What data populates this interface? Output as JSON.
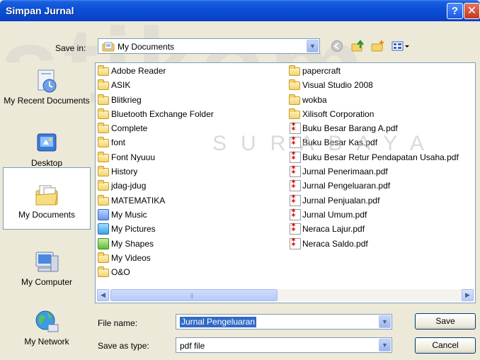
{
  "window": {
    "title": "Simpan Jurnal",
    "help_label": "?",
    "close_label": "✕"
  },
  "watermark": {
    "big": "stikom",
    "small": "SURABAYA"
  },
  "save_in": {
    "label": "Save in:",
    "value": "My Documents"
  },
  "places": [
    {
      "label": "My Recent Documents",
      "icon": "recent-documents-icon"
    },
    {
      "label": "Desktop",
      "icon": "desktop-icon"
    },
    {
      "label": "My Documents",
      "icon": "my-documents-icon"
    },
    {
      "label": "My Computer",
      "icon": "my-computer-icon"
    },
    {
      "label": "My Network",
      "icon": "my-network-icon"
    }
  ],
  "files_col1": [
    {
      "name": "Adobe Reader",
      "type": "folder"
    },
    {
      "name": "ASIK",
      "type": "folder"
    },
    {
      "name": "Blitkrieg",
      "type": "folder"
    },
    {
      "name": "Bluetooth Exchange Folder",
      "type": "folder"
    },
    {
      "name": "Complete",
      "type": "folder"
    },
    {
      "name": "font",
      "type": "folder"
    },
    {
      "name": "Font Nyuuu",
      "type": "folder"
    },
    {
      "name": "History",
      "type": "folder"
    },
    {
      "name": "jdag-jdug",
      "type": "folder"
    },
    {
      "name": "MATEMATIKA",
      "type": "folder"
    },
    {
      "name": "My Music",
      "type": "music"
    },
    {
      "name": "My Pictures",
      "type": "pictures"
    },
    {
      "name": "My Shapes",
      "type": "shapes"
    },
    {
      "name": "My Videos",
      "type": "folder"
    },
    {
      "name": "O&O",
      "type": "folder"
    }
  ],
  "files_col2": [
    {
      "name": "papercraft",
      "type": "folder"
    },
    {
      "name": "Visual Studio 2008",
      "type": "folder"
    },
    {
      "name": "wokba",
      "type": "folder"
    },
    {
      "name": "Xilisoft Corporation",
      "type": "folder"
    },
    {
      "name": "Buku Besar Barang A.pdf",
      "type": "pdf"
    },
    {
      "name": "Buku Besar Kas.pdf",
      "type": "pdf"
    },
    {
      "name": "Buku Besar Retur Pendapatan Usaha.pdf",
      "type": "pdf"
    },
    {
      "name": "Jurnal Penerimaan.pdf",
      "type": "pdf"
    },
    {
      "name": "Jurnal Pengeluaran.pdf",
      "type": "pdf"
    },
    {
      "name": "Jurnal Penjualan.pdf",
      "type": "pdf"
    },
    {
      "name": "Jurnal Umum.pdf",
      "type": "pdf"
    },
    {
      "name": "Neraca Lajur.pdf",
      "type": "pdf"
    },
    {
      "name": "Neraca Saldo.pdf",
      "type": "pdf"
    }
  ],
  "file_name": {
    "label": "File name:",
    "value": "Jurnal Pengeluaran"
  },
  "save_as_type": {
    "label": "Save as type:",
    "value": "pdf file"
  },
  "buttons": {
    "save": "Save",
    "cancel": "Cancel"
  },
  "scrollbar": {
    "left_arrow": "◀",
    "right_arrow": "▶",
    "grip": "|||"
  },
  "dropdown_arrow": "▼",
  "colors": {
    "titlebar": "#0a4fd6",
    "selection": "#316ac5",
    "window_bg": "#ece9d8"
  }
}
